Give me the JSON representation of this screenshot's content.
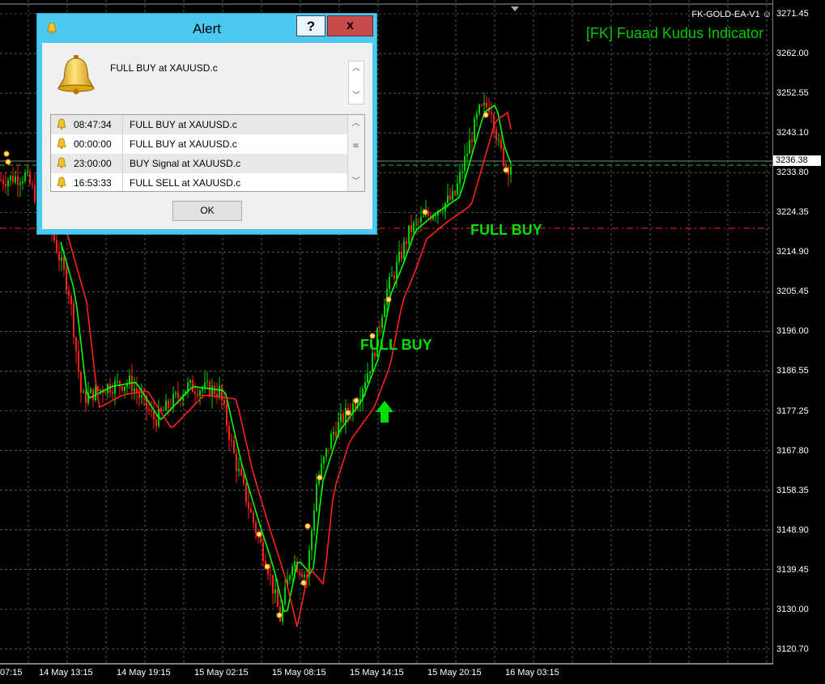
{
  "chart": {
    "ea_label": "FK-GOLD-EA-V1 ☺",
    "indicator_title": "[FK] Fuaad Kudus Indicator",
    "current_price": "3236.38",
    "price_axis": [
      "3271.45",
      "3262.00",
      "3252.55",
      "3243.10",
      "3233.80",
      "3224.35",
      "3214.90",
      "3205.45",
      "3196.00",
      "3186.55",
      "3177.25",
      "3167.80",
      "3158.35",
      "3148.90",
      "3139.45",
      "3130.00",
      "3120.70"
    ],
    "time_axis": [
      "07:15",
      "14 May 13:15",
      "14 May 19:15",
      "15 May 02:15",
      "15 May 08:15",
      "15 May 14:15",
      "15 May 20:15",
      "16 May 03:15"
    ],
    "signals": {
      "full_buy_1": "FULL BUY",
      "full_buy_2": "FULL BUY"
    },
    "colors": {
      "bull": "#00d000",
      "bear": "#ff2020",
      "fast_ma": "#00ff00",
      "slow_ma": "#ff2020",
      "grid": "#ffffff"
    }
  },
  "alert": {
    "title": "Alert",
    "help_label": "?",
    "close_label": "x",
    "message": "FULL BUY at XAUUSD.c",
    "ok_label": "OK",
    "history": [
      {
        "time": "08:47:34",
        "message": "FULL BUY at XAUUSD.c"
      },
      {
        "time": "00:00:00",
        "message": "FULL BUY at XAUUSD.c"
      },
      {
        "time": "23:00:00",
        "message": "BUY Signal at XAUUSD.c"
      },
      {
        "time": "16:53:33",
        "message": "FULL SELL at XAUUSD.c"
      }
    ],
    "icons": {
      "title": "bell-icon",
      "big": "bell-icon",
      "row": "bell-icon"
    }
  }
}
